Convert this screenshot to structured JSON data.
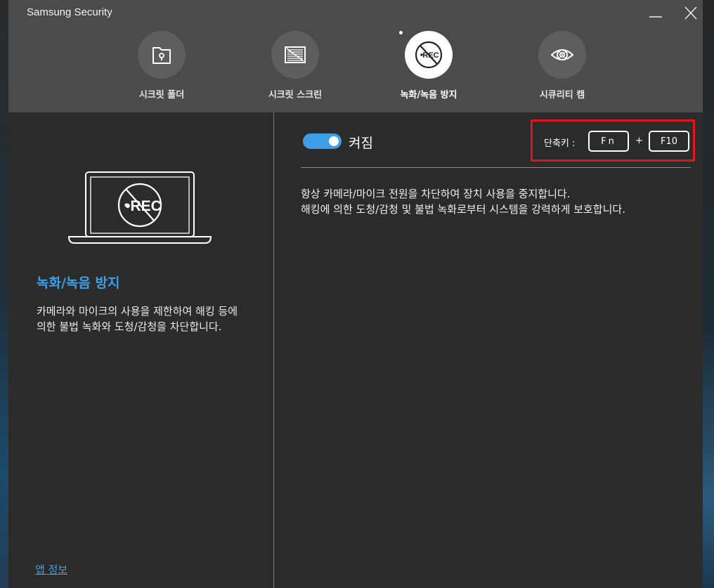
{
  "window": {
    "title": "Samsung Security"
  },
  "nav": {
    "items": [
      {
        "label": "시크릿 폴더",
        "icon": "secret-folder-icon",
        "active": false
      },
      {
        "label": "시크릿 스크린",
        "icon": "secret-screen-icon",
        "active": false
      },
      {
        "label": "녹화/녹음 방지",
        "icon": "rec-block-icon",
        "active": true
      },
      {
        "label": "시큐리티 캠",
        "icon": "security-cam-icon",
        "active": false
      }
    ]
  },
  "sidebar": {
    "illustration_text": "•REC",
    "title": "녹화/녹음 방지",
    "description": "카메라와 마이크의 사용을 제한하여 해킹 등에 의한 불법 녹화와 도청/감청을 차단합니다.",
    "app_info_link": "앱 정보"
  },
  "main": {
    "toggle_label": "켜짐",
    "toggle_on": true,
    "shortcut": {
      "label": "단축키 :",
      "key1": "Fn",
      "plus": "+",
      "key2": "F10"
    },
    "description_line1": "항상 카메라/마이크 전원을 차단하여 장치 사용을 중지합니다.",
    "description_line2": "해킹에 의한 도청/감청 및 불법 녹화로부터 시스템을 강력하게 보호합니다."
  },
  "colors": {
    "accent": "#3ea0e8",
    "highlight_border": "#e0141e",
    "header_bg": "#4b4b4b",
    "panel_bg": "#2b2b2b"
  }
}
